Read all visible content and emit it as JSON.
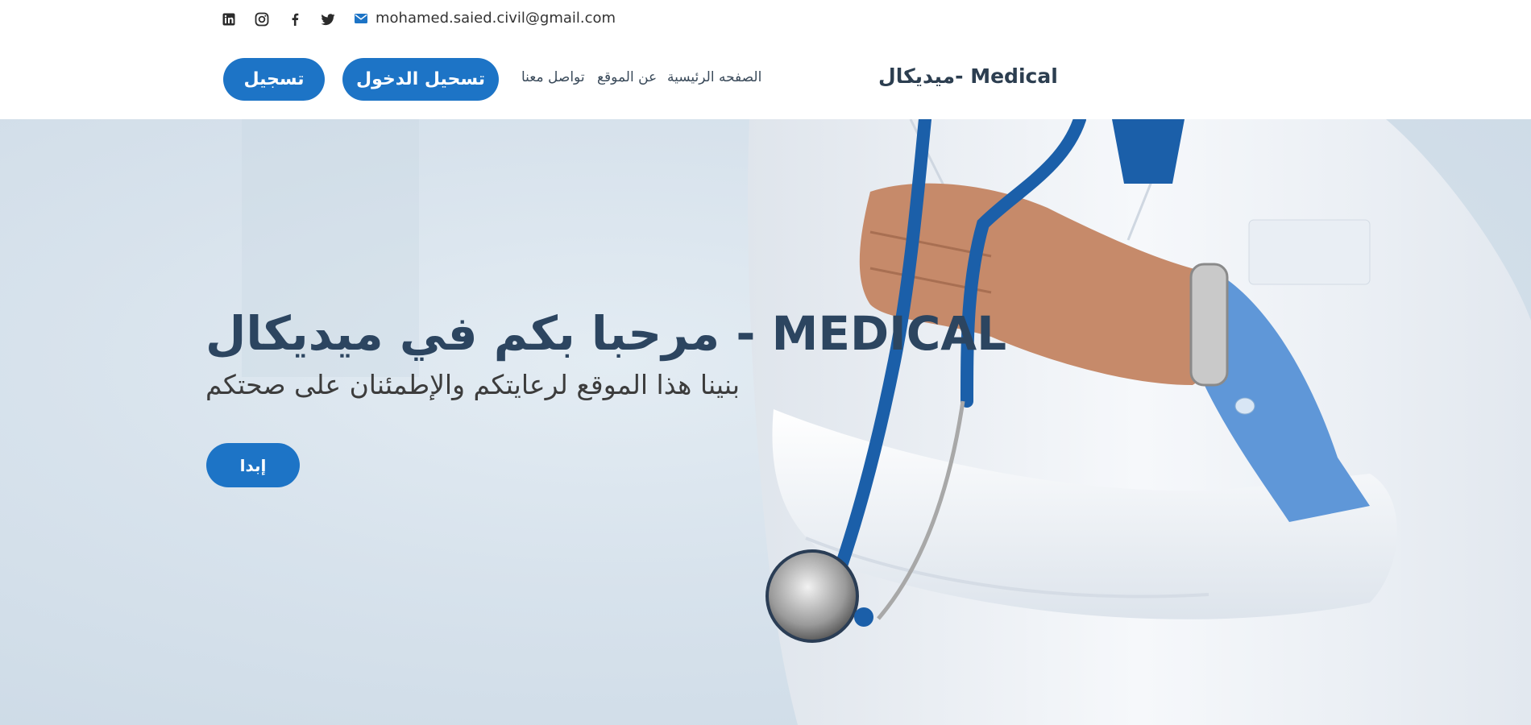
{
  "topbar": {
    "social_icons": [
      "linkedin-icon",
      "instagram-icon",
      "facebook-icon",
      "twitter-icon"
    ],
    "email": "mohamed.saied.civil@gmail.com"
  },
  "header": {
    "register_label": "تسجيل",
    "login_label": "تسحيل الدخول",
    "nav": {
      "contact": "تواصل معنا",
      "about": "عن الموقع",
      "home": "الصفحه الرئيسية"
    },
    "brand": "ميديكال- Medical"
  },
  "hero": {
    "title": "مرحبا بكم في ميديكال - MEDICAL",
    "subtitle": "بنينا هذا الموقع لرعايتكم والإطمئنان على صحتكم",
    "start_label": "إبدا"
  },
  "colors": {
    "accent": "#1d74c6",
    "title": "#2c4560",
    "coat_sleeve": "#5f97d8",
    "stethoscope": "#1b5fa9"
  }
}
